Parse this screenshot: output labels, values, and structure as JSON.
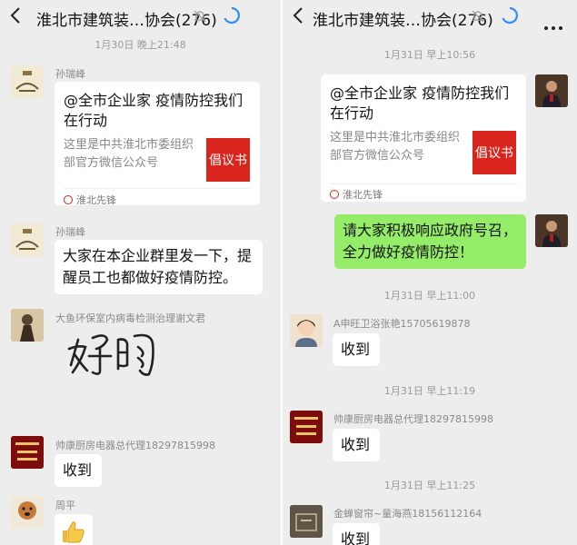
{
  "left": {
    "header": {
      "title": "淮北市建筑装…协会(276)"
    },
    "messages": {
      "t1": "1月30日 晚上21:48",
      "s1": "孙瑞峰",
      "card": {
        "title": "@全市企业家 疫情防控我们在行动",
        "desc": "这里是中共淮北市委组织部官方微信公众号",
        "thumb": "倡议书",
        "source": "淮北先锋"
      },
      "s2": "孙瑞峰",
      "b2": "大家在本企业群里发一下，提醒员工也都做好疫情防控。",
      "s3": "大鱼环保室内病毒检测治理谢文君",
      "handwriting": "好的",
      "s4": "帅康厨房电器总代理18297815998",
      "b4": "收到",
      "s5": "周平"
    }
  },
  "right": {
    "header": {
      "title": "淮北市建筑装…协会(276)"
    },
    "messages": {
      "t1": "1月31日 早上10:56",
      "card": {
        "title": "@全市企业家 疫情防控我们在行动",
        "desc": "这里是中共淮北市委组织部官方微信公众号",
        "thumb": "倡议书",
        "source": "淮北先锋"
      },
      "b1": "请大家积极响应政府号召，全力做好疫情防控！",
      "t2": "1月31日 早上11:00",
      "s2": "A申旺卫浴张艳15705619878",
      "b2": "收到",
      "t3": "1月31日 早上11:19",
      "s3": "帅康厨房电器总代理18297815998",
      "b3": "收到",
      "t4": "1月31日 早上11:25",
      "s4": "金蝉窗帘~童海燕18156112164",
      "b4": "收到"
    }
  },
  "colors": {
    "bg": "#ededed",
    "bubble": "#ffffff",
    "self_bubble": "#95ec69",
    "thumb": "#d9251d",
    "loader": "#2f8cff"
  }
}
